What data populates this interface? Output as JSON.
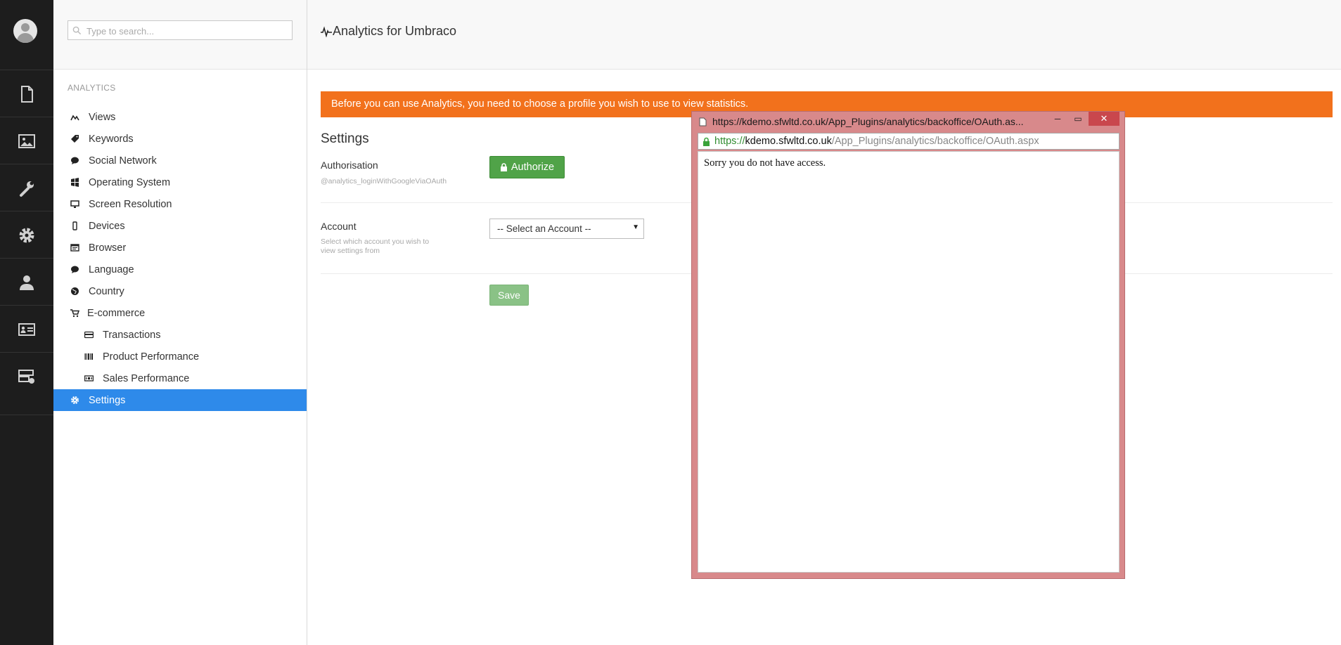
{
  "search": {
    "placeholder": "Type to search..."
  },
  "tree": {
    "section_title": "ANALYTICS",
    "items": [
      {
        "label": "Views",
        "icon": "line-chart-icon"
      },
      {
        "label": "Keywords",
        "icon": "tag-icon"
      },
      {
        "label": "Social Network",
        "icon": "speech-bubble-icon"
      },
      {
        "label": "Operating System",
        "icon": "windows-logo-icon"
      },
      {
        "label": "Screen Resolution",
        "icon": "monitor-icon"
      },
      {
        "label": "Devices",
        "icon": "mobile-icon"
      },
      {
        "label": "Browser",
        "icon": "browser-icon"
      },
      {
        "label": "Language",
        "icon": "speech-bubble-icon"
      },
      {
        "label": "Country",
        "icon": "globe-icon"
      },
      {
        "label": "E-commerce",
        "icon": "cart-icon"
      },
      {
        "label": "Transactions",
        "icon": "credit-card-icon"
      },
      {
        "label": "Product Performance",
        "icon": "barcode-icon"
      },
      {
        "label": "Sales Performance",
        "icon": "money-icon"
      },
      {
        "label": "Settings",
        "icon": "gear-icon"
      }
    ]
  },
  "main": {
    "title": "Analytics for Umbraco",
    "alert": "Before you can use Analytics, you need to choose a profile you wish to use to view statistics.",
    "settings_heading": "Settings",
    "authorisation": {
      "label": "Authorisation",
      "desc": "@analytics_loginWithGoogleViaOAuth",
      "button": "Authorize"
    },
    "account": {
      "label": "Account",
      "desc": "Select which account you wish to view settings from",
      "select_value": "-- Select an Account --"
    },
    "save_label": "Save"
  },
  "popup": {
    "title": "https://kdemo.sfwltd.co.uk/App_Plugins/analytics/backoffice/OAuth.as...",
    "url_scheme": "https://",
    "url_host": "kdemo.sfwltd.co.uk",
    "url_path": "/App_Plugins/analytics/backoffice/OAuth.aspx",
    "message": "Sorry you do not have access."
  },
  "colors": {
    "rail": "#1d1d1d",
    "selected": "#2e8aea",
    "alert": "#f2711c",
    "authorize": "#50a348",
    "save": "#8ac286",
    "popup_frame": "#d8898b"
  }
}
